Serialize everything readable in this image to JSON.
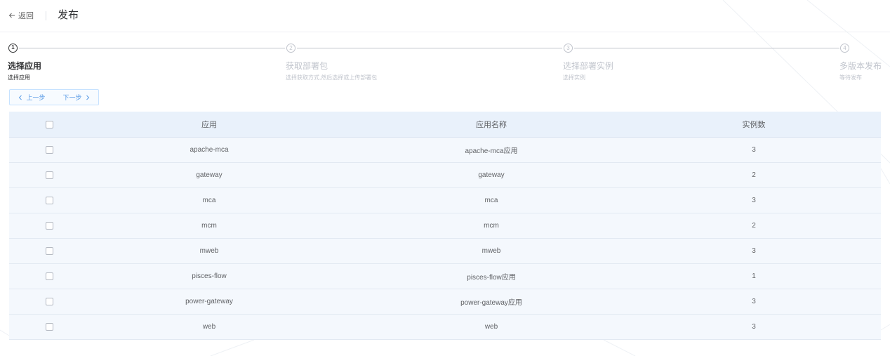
{
  "header": {
    "back_icon": "arrow-left-icon",
    "back_label": "返回",
    "title": "发布"
  },
  "steps": {
    "current": 1,
    "items": [
      {
        "number": "1",
        "title": "选择应用",
        "description": "选择应用"
      },
      {
        "number": "2",
        "title": "获取部署包",
        "description": "选择获取方式,然后选择或上传部署包"
      },
      {
        "number": "3",
        "title": "选择部署实例",
        "description": "选择实例"
      },
      {
        "number": "4",
        "title": "多版本发布",
        "description": "等待发布"
      }
    ]
  },
  "nav_buttons": {
    "prev_icon": "chevron-left-icon",
    "prev_label": "上一步",
    "next_label": "下一步",
    "next_icon": "chevron-right-icon"
  },
  "table": {
    "select_all_checked": false,
    "columns": [
      "应用",
      "应用名称",
      "实例数"
    ],
    "rows": [
      {
        "app": "apache-mca",
        "app_name": "apache-mca应用",
        "instances": 3,
        "checked": false
      },
      {
        "app": "gateway",
        "app_name": "gateway",
        "instances": 2,
        "checked": false
      },
      {
        "app": "mca",
        "app_name": "mca",
        "instances": 3,
        "checked": false
      },
      {
        "app": "mcm",
        "app_name": "mcm",
        "instances": 2,
        "checked": false
      },
      {
        "app": "mweb",
        "app_name": "mweb",
        "instances": 3,
        "checked": false
      },
      {
        "app": "pisces-flow",
        "app_name": "pisces-flow应用",
        "instances": 1,
        "checked": false
      },
      {
        "app": "power-gateway",
        "app_name": "power-gateway应用",
        "instances": 3,
        "checked": false
      },
      {
        "app": "web",
        "app_name": "web",
        "instances": 3,
        "checked": false
      }
    ]
  },
  "colors": {
    "active": "#303133",
    "inactive": "#c0c4cc",
    "accent": "#5a9be6",
    "table_header_bg": "#e9f1fb",
    "table_row_bg": "#f4f8fd",
    "table_row_border": "#e2e9f2"
  }
}
